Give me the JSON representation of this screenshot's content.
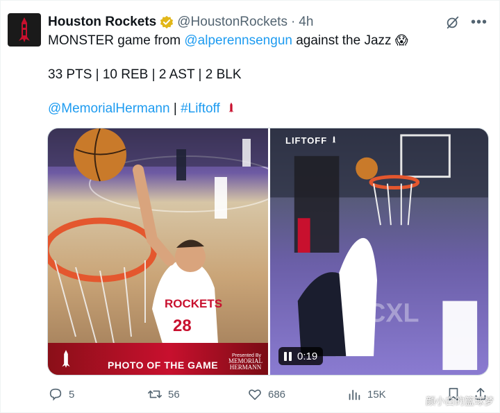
{
  "author": {
    "display_name": "Houston Rockets",
    "handle": "@HoustonRockets",
    "separator": "·",
    "time": "4h",
    "avatar_icon": "rockets-logo-icon",
    "verified_icon": "verified-gold-badge-icon"
  },
  "tweet": {
    "line1_prefix": "MONSTER game from ",
    "line1_mention": "@alperennsengun",
    "line1_suffix": " against the Jazz ",
    "line1_emoji": "😱",
    "stats_line": "33 PTS | 10 REB | 2 AST | 2 BLK",
    "line3_mention": "@MemorialHermann",
    "line3_separator": " | ",
    "line3_hashtag": "#Liftoff"
  },
  "media": {
    "photo_label": "PHOTO OF THE GAME",
    "sponsor_small": "Presented By",
    "sponsor_name_1": "MEMORIAL",
    "sponsor_name_2": "HERMANN",
    "video_brand": "LIFTOFF",
    "video_time": "0:19"
  },
  "actions": {
    "replies": "5",
    "retweets": "56",
    "likes": "686",
    "views": "15K"
  },
  "watermark": "颜小白的篮球梦",
  "colors": {
    "link": "#1d9bf0",
    "secondary_text": "#536471",
    "rockets_red": "#c8102e",
    "verified_gold": "#e2b719"
  }
}
